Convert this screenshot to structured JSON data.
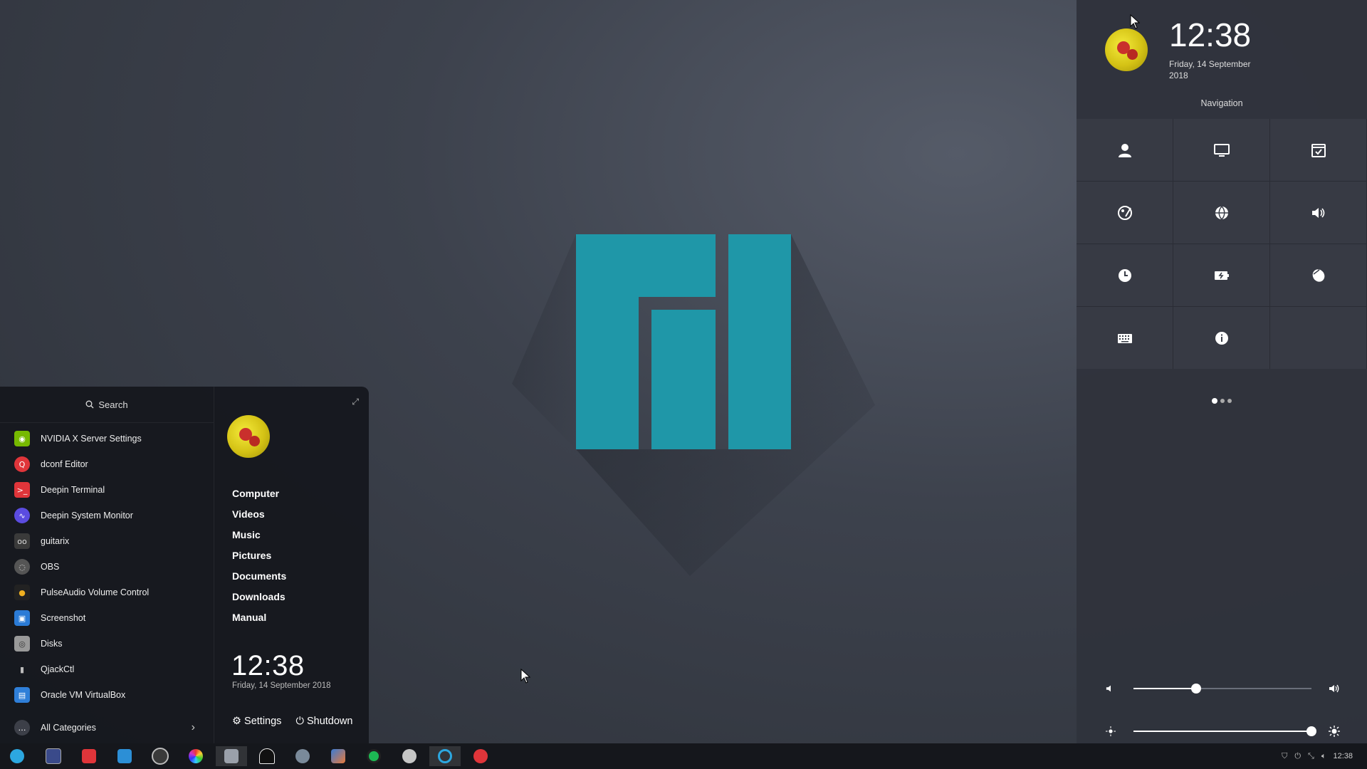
{
  "desktop": {
    "logo": "manjaro-logo"
  },
  "start_menu": {
    "search_label": "Search",
    "apps": [
      {
        "label": "NVIDIA X Server Settings",
        "icon": "nvidia-icon",
        "color": "#76b900"
      },
      {
        "label": "dconf Editor",
        "icon": "dconf-icon",
        "color": "#e0353a"
      },
      {
        "label": "Deepin Terminal",
        "icon": "terminal-icon",
        "color": "#e0353a"
      },
      {
        "label": "Deepin System Monitor",
        "icon": "system-monitor-icon",
        "color": "#5b4ce0"
      },
      {
        "label": "guitarix",
        "icon": "guitarix-icon",
        "color": "#3a3a3a"
      },
      {
        "label": "OBS",
        "icon": "obs-icon",
        "color": "#555"
      },
      {
        "label": "PulseAudio Volume Control",
        "icon": "pulseaudio-icon",
        "color": "#f0b020"
      },
      {
        "label": "Screenshot",
        "icon": "screenshot-icon",
        "color": "#2b7bd6"
      },
      {
        "label": "Disks",
        "icon": "disks-icon",
        "color": "#999"
      },
      {
        "label": "QjackCtl",
        "icon": "qjackctl-icon",
        "color": "#bbb"
      },
      {
        "label": "Oracle VM VirtualBox",
        "icon": "virtualbox-icon",
        "color": "#2f7fd8"
      }
    ],
    "all_categories": "All Categories",
    "places": [
      "Computer",
      "Videos",
      "Music",
      "Pictures",
      "Documents",
      "Downloads",
      "Manual"
    ],
    "clock": "12:38",
    "date": "Friday, 14 September 2018",
    "settings_label": "Settings",
    "shutdown_label": "Shutdown"
  },
  "panel": {
    "clock": "12:38",
    "date": "Friday, 14 September 2018",
    "nav_title": "Navigation",
    "tiles": [
      {
        "name": "accounts-icon"
      },
      {
        "name": "display-icon"
      },
      {
        "name": "default-apps-icon"
      },
      {
        "name": "personalization-icon"
      },
      {
        "name": "network-icon"
      },
      {
        "name": "sound-icon"
      },
      {
        "name": "time-date-icon"
      },
      {
        "name": "power-icon"
      },
      {
        "name": "mouse-icon"
      },
      {
        "name": "keyboard-icon"
      },
      {
        "name": "system-info-icon"
      }
    ],
    "volume_level": 0.35,
    "brightness_level": 1.0
  },
  "taskbar": {
    "clock": "12:38",
    "items": [
      "launcher-icon",
      "monitor-app-icon",
      "terminal-app-icon",
      "system-monitor-app-icon",
      "obs-app-icon",
      "color-picker-icon",
      "file-manager-icon",
      "inkscape-icon",
      "gimp-icon",
      "krita-icon",
      "spotify-icon",
      "steam-icon",
      "refresh-app-icon",
      "settings-app-icon"
    ],
    "colors": {
      "accent": "#2ca7e0",
      "manjaro": "#1f97a8"
    }
  }
}
